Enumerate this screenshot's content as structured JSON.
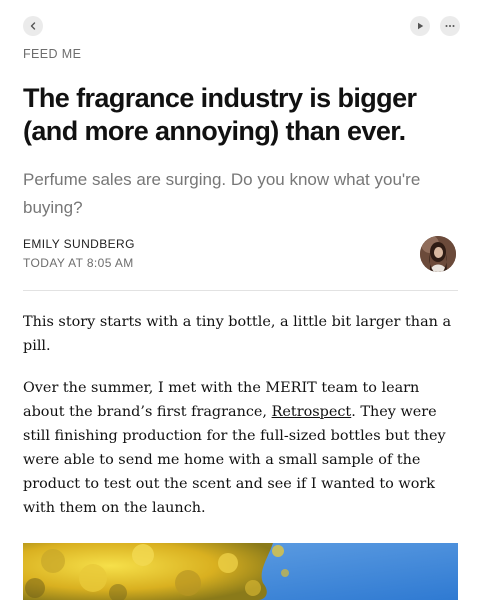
{
  "topbar": {
    "back_icon": "chevron-left-icon",
    "play_icon": "play-icon",
    "more_icon": "ellipsis-icon"
  },
  "article": {
    "publication": "FEED ME",
    "title": "The fragrance industry is bigger (and more annoying) than ever.",
    "subtitle": "Perfume sales are surging. Do you know what you're buying?",
    "author": "EMILY SUNDBERG",
    "date": "TODAY AT 8:05 AM",
    "paragraph1": "This story starts with a tiny bottle, a little bit larger than a pill.",
    "paragraph2_before": "Over the summer, I met with the MERIT team to learn about the brand’s first fragrance, ",
    "paragraph2_link": "Retrospect",
    "paragraph2_after": ". They were still finishing production for the full-sized bottles but they were able to send me home with a small sample of the product to test out the scent and see if I wanted to work with them on the launch."
  },
  "colors": {
    "text": "#111111",
    "muted": "#6e6e6e",
    "subtitle": "#777777",
    "button_bg": "#ebebeb",
    "divider": "#e2e2e2",
    "sky": "#4a90d9",
    "foliage": "#e8c22c"
  }
}
